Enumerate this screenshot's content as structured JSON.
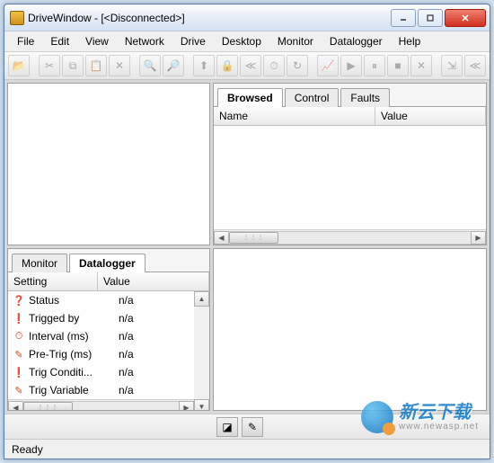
{
  "window": {
    "title": "DriveWindow - [<Disconnected>]"
  },
  "menu": {
    "file": "File",
    "edit": "Edit",
    "view": "View",
    "network": "Network",
    "drive": "Drive",
    "desktop": "Desktop",
    "monitor": "Monitor",
    "datalogger": "Datalogger",
    "help": "Help"
  },
  "toolbar_icons": {
    "open": "open-icon",
    "cut": "cut-icon",
    "copy": "copy-icon",
    "paste": "paste-icon",
    "delete": "delete-icon",
    "zoomin": "zoom-in-icon",
    "zoomout": "zoom-out-icon",
    "upload": "upload-icon",
    "lock": "lock-icon",
    "rewind": "rewind-icon",
    "clock": "clock-icon",
    "refresh": "refresh-icon",
    "chart": "chart-icon",
    "play": "play-icon",
    "pause": "pause-icon",
    "stop": "stop-icon",
    "cancel": "cancel-icon",
    "export": "export-icon",
    "skipback": "skip-back-icon"
  },
  "topright": {
    "tabs": {
      "browsed": "Browsed",
      "control": "Control",
      "faults": "Faults"
    },
    "headers": {
      "name": "Name",
      "value": "Value"
    }
  },
  "botleft": {
    "tabs": {
      "monitor": "Monitor",
      "datalogger": "Datalogger"
    },
    "headers": {
      "setting": "Setting",
      "value": "Value"
    },
    "rows": [
      {
        "icon": "❓",
        "color": "#d02020",
        "setting": "Status",
        "value": "n/a"
      },
      {
        "icon": "❗",
        "color": "#d02020",
        "setting": "Trigged by",
        "value": "n/a"
      },
      {
        "icon": "⏱",
        "color": "#c04030",
        "setting": "Interval (ms)",
        "value": "n/a"
      },
      {
        "icon": "✎",
        "color": "#c05020",
        "setting": "Pre-Trig (ms)",
        "value": "n/a"
      },
      {
        "icon": "❗",
        "color": "#d02020",
        "setting": "Trig Conditi...",
        "value": "n/a"
      },
      {
        "icon": "✎",
        "color": "#c05020",
        "setting": "Trig Variable",
        "value": "n/a"
      }
    ]
  },
  "status": {
    "text": "Ready"
  },
  "watermark": {
    "text": "新云下载",
    "sub": "www.newasp.net"
  }
}
